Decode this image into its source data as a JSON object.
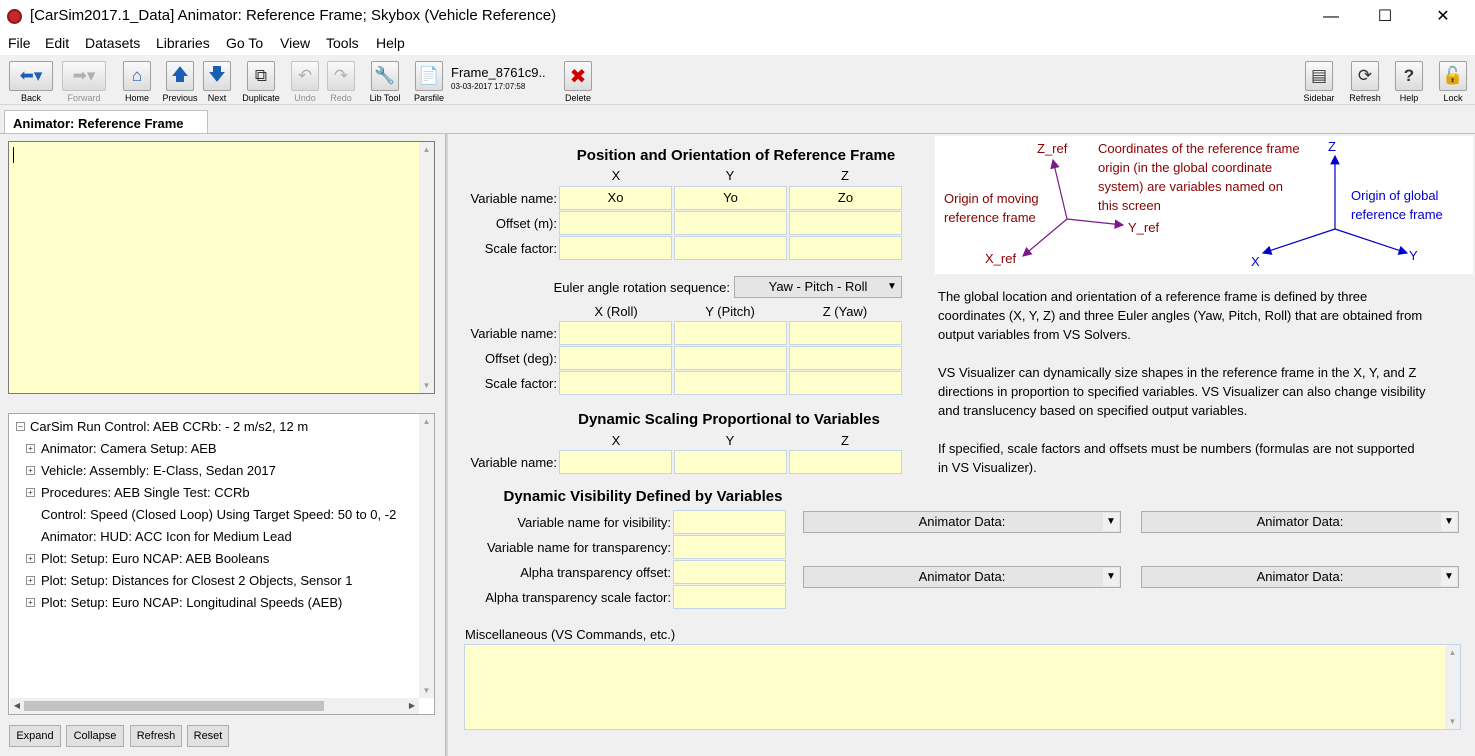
{
  "window": {
    "title": "[CarSim2017.1_Data] Animator: Reference Frame; Skybox (Vehicle Reference)"
  },
  "menu": [
    "File",
    "Edit",
    "Datasets",
    "Libraries",
    "Go To",
    "View",
    "Tools",
    "Help"
  ],
  "toolbar": {
    "back": "Back",
    "forward": "Forward",
    "home": "Home",
    "previous": "Previous",
    "next": "Next",
    "duplicate": "Duplicate",
    "undo": "Undo",
    "redo": "Redo",
    "libtool": "Lib Tool",
    "parsfile": "Parsfile",
    "dataset_name": "Frame_8761c9..",
    "dataset_date": "03-03-2017 17:07:58",
    "delete": "Delete",
    "sidebar": "Sidebar",
    "refresh": "Refresh",
    "help": "Help",
    "lock": "Lock"
  },
  "tab": "Animator: Reference Frame",
  "tree": {
    "root": "CarSim Run Control: AEB  CCRb: - 2 m/s2, 12 m",
    "items": [
      {
        "label": "Animator: Camera Setup: AEB",
        "expandable": true
      },
      {
        "label": "Vehicle: Assembly: E-Class, Sedan 2017",
        "expandable": true
      },
      {
        "label": "Procedures: AEB Single Test: CCRb",
        "expandable": true
      },
      {
        "label": "Control: Speed (Closed Loop) Using Target Speed: 50 to 0, -2",
        "expandable": false
      },
      {
        "label": "Animator: HUD: ACC Icon for Medium Lead",
        "expandable": false
      },
      {
        "label": "Plot: Setup: Euro NCAP: AEB Booleans",
        "expandable": true
      },
      {
        "label": "Plot: Setup: Distances for Closest 2 Objects, Sensor 1",
        "expandable": true
      },
      {
        "label": "Plot: Setup: Euro NCAP: Longitudinal Speeds (AEB)",
        "expandable": true
      }
    ]
  },
  "tree_buttons": {
    "expand": "Expand",
    "collapse": "Collapse",
    "refresh": "Refresh",
    "reset": "Reset"
  },
  "position": {
    "title": "Position and Orientation of Reference Frame",
    "cols": [
      "X",
      "Y",
      "Z"
    ],
    "rows": [
      "Variable name:",
      "Offset (m):",
      "Scale factor:"
    ],
    "var_values": [
      "Xo",
      "Yo",
      "Zo"
    ]
  },
  "euler": {
    "label": "Euler angle rotation sequence:",
    "value": "Yaw - Pitch - Roll",
    "cols": [
      "X (Roll)",
      "Y (Pitch)",
      "Z (Yaw)"
    ],
    "rows": [
      "Variable name:",
      "Offset (deg):",
      "Scale factor:"
    ]
  },
  "scaling": {
    "title": "Dynamic Scaling Proportional to Variables",
    "cols": [
      "X",
      "Y",
      "Z"
    ],
    "row": "Variable name:"
  },
  "visibility": {
    "title": "Dynamic Visibility Defined by Variables",
    "rows": [
      "Variable name for visibility:",
      "Variable name for transparency:",
      "Alpha transparency offset:",
      "Alpha transparency scale factor:"
    ],
    "dropdown": "Animator Data:"
  },
  "misc_label": "Miscellaneous (VS Commands, etc.)",
  "diagram": {
    "z_ref": "Z_ref",
    "y_ref": "Y_ref",
    "x_ref": "X_ref",
    "z": "Z",
    "y": "Y",
    "x": "X",
    "moving_origin": [
      "Origin of moving",
      "reference frame"
    ],
    "coords_note": [
      "Coordinates of the reference frame",
      "origin (in the global coordinate",
      "system) are variables  named on",
      "this screen"
    ],
    "global_origin": [
      "Origin of global",
      "reference frame"
    ],
    "colors": {
      "red": "#8b0000",
      "blue": "#0000cc",
      "purple": "#7a1a8a"
    }
  },
  "description": [
    [
      "The global location and orientation of a reference frame is defined by three",
      "coordinates (X, Y, Z) and three Euler angles (Yaw, Pitch, Roll) that are obtained from",
      "output variables from VS Solvers."
    ],
    [
      "VS Visualizer can dynamically size shapes in the reference frame in the X, Y, and Z",
      "directions in proportion to specified variables. VS Visualizer can also change visibility",
      "and translucency based on specified output variables."
    ],
    [
      "If specified, scale factors and offsets must be numbers (formulas are not supported",
      "in VS Visualizer)."
    ]
  ]
}
